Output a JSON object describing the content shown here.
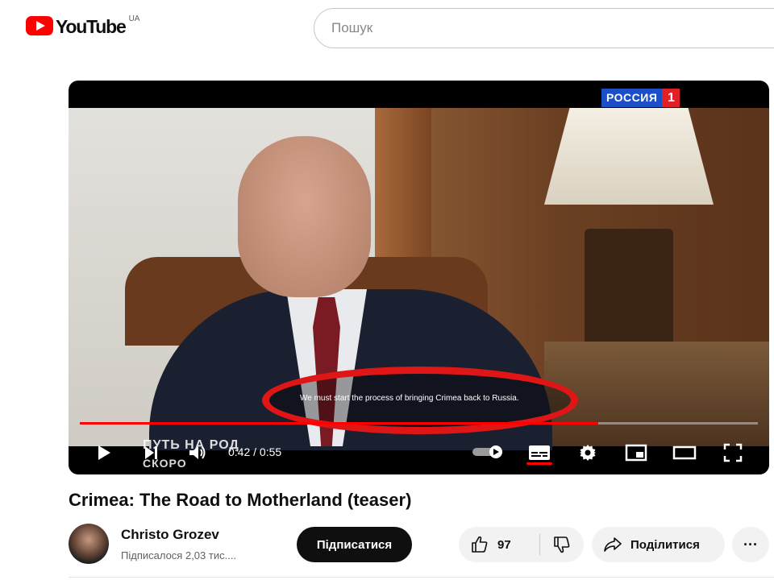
{
  "header": {
    "logo_text": "YouTube",
    "region": "UA",
    "search_placeholder": "Пошук"
  },
  "player": {
    "channel_logo_name": "РОССИЯ",
    "channel_logo_number": "1",
    "promo_title": "ПУТЬ НА РОД",
    "promo_subtitle": "СКОРО",
    "caption": "We must start the process of bringing Crimea back to Russia.",
    "caption_highlight_color": "#e01616",
    "time_display": "0:42 / 0:55",
    "progress_fraction": 0.764,
    "captions_on": true,
    "icons": [
      "play-icon",
      "next-icon",
      "volume-icon",
      "autoplay-toggle-icon",
      "subtitles-icon",
      "settings-icon",
      "miniplayer-icon",
      "theater-mode-icon",
      "fullscreen-icon"
    ]
  },
  "video": {
    "title": "Crimea: The Road to Motherland (teaser)"
  },
  "channel": {
    "name": "Christo Grozev",
    "subscribers": "Підписалося 2,03 тис...."
  },
  "actions": {
    "subscribe_label": "Підписатися",
    "like_count": "97",
    "share_label": "Поділитися",
    "more_label": "···"
  },
  "colors": {
    "brand_red": "#ff0000",
    "progress": "#ff0000",
    "subscribe_bg": "#0f0f0f"
  }
}
